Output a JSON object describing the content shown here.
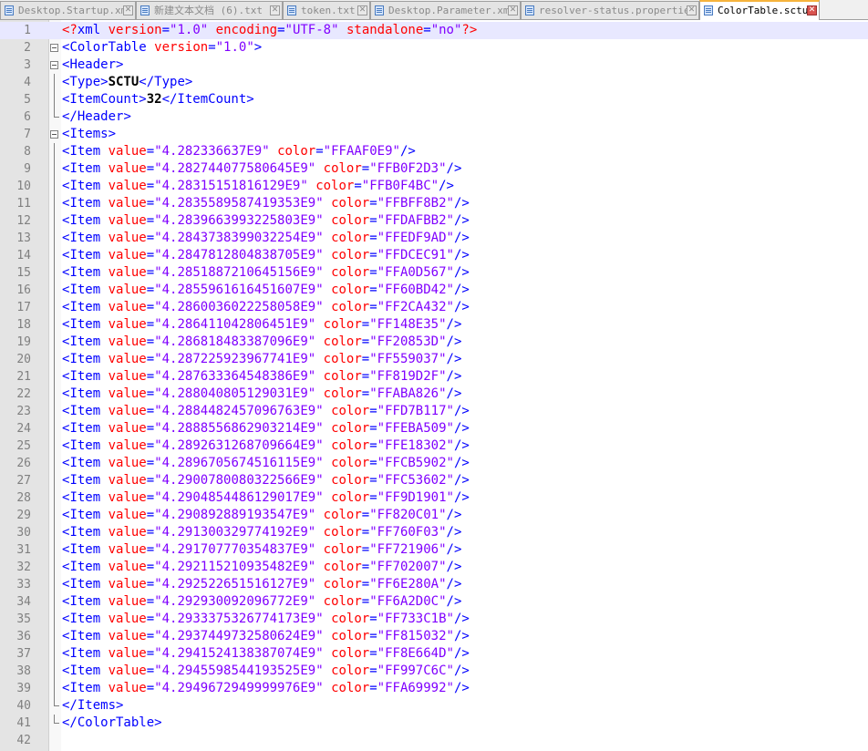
{
  "tabs": [
    {
      "label": "Desktop.Startup.xml",
      "active": false
    },
    {
      "label": "新建文本文档 (6).txt",
      "active": false
    },
    {
      "label": "token.txt",
      "active": false
    },
    {
      "label": "Desktop.Parameter.xml",
      "active": false
    },
    {
      "label": "resolver-status.properties",
      "active": false
    },
    {
      "label": "ColorTable.sctu",
      "active": true
    }
  ],
  "colors": {
    "tag": "#0000ff",
    "attribute": "#ff0000",
    "value": "#8000ff",
    "active_tab_accent": "#f6b33c",
    "current_line": "#e8e8ff"
  },
  "icons": {
    "tab": "document-icon",
    "close": "close-icon",
    "fold": "fold-minus-icon"
  },
  "document": {
    "prolog": {
      "version": "\"1.0\"",
      "encoding": "\"UTF-8\"",
      "standalone": "\"no\""
    },
    "root": {
      "tag": "ColorTable",
      "version": "\"1.0\""
    },
    "header": {
      "tag": "Header",
      "type": "SCTU",
      "item_count": "32"
    },
    "items_tag": "Items",
    "item_tag": "Item",
    "items": [
      {
        "value": "\"4.282336637E9\"",
        "color": "\"FFAAF0E9\""
      },
      {
        "value": "\"4.282744077580645E9\"",
        "color": "\"FFB0F2D3\""
      },
      {
        "value": "\"4.28315151816129E9\"",
        "color": "\"FFB0F4BC\""
      },
      {
        "value": "\"4.2835589587419353E9\"",
        "color": "\"FFBFF8B2\""
      },
      {
        "value": "\"4.2839663993225803E9\"",
        "color": "\"FFDAFBB2\""
      },
      {
        "value": "\"4.2843738399032254E9\"",
        "color": "\"FFEDF9AD\""
      },
      {
        "value": "\"4.2847812804838705E9\"",
        "color": "\"FFDCEC91\""
      },
      {
        "value": "\"4.2851887210645156E9\"",
        "color": "\"FFA0D567\""
      },
      {
        "value": "\"4.2855961616451607E9\"",
        "color": "\"FF60BD42\""
      },
      {
        "value": "\"4.2860036022258058E9\"",
        "color": "\"FF2CA432\""
      },
      {
        "value": "\"4.286411042806451E9\"",
        "color": "\"FF148E35\""
      },
      {
        "value": "\"4.286818483387096E9\"",
        "color": "\"FF20853D\""
      },
      {
        "value": "\"4.287225923967741E9\"",
        "color": "\"FF559037\""
      },
      {
        "value": "\"4.287633364548386E9\"",
        "color": "\"FF819D2F\""
      },
      {
        "value": "\"4.288040805129031E9\"",
        "color": "\"FFABA826\""
      },
      {
        "value": "\"4.2884482457096763E9\"",
        "color": "\"FFD7B117\""
      },
      {
        "value": "\"4.2888556862903214E9\"",
        "color": "\"FFEBA509\""
      },
      {
        "value": "\"4.2892631268709664E9\"",
        "color": "\"FFE18302\""
      },
      {
        "value": "\"4.2896705674516115E9\"",
        "color": "\"FFCB5902\""
      },
      {
        "value": "\"4.2900780080322566E9\"",
        "color": "\"FFC53602\""
      },
      {
        "value": "\"4.2904854486129017E9\"",
        "color": "\"FF9D1901\""
      },
      {
        "value": "\"4.290892889193547E9\"",
        "color": "\"FF820C01\""
      },
      {
        "value": "\"4.291300329774192E9\"",
        "color": "\"FF760F03\""
      },
      {
        "value": "\"4.291707770354837E9\"",
        "color": "\"FF721906\""
      },
      {
        "value": "\"4.292115210935482E9\"",
        "color": "\"FF702007\""
      },
      {
        "value": "\"4.292522651516127E9\"",
        "color": "\"FF6E280A\""
      },
      {
        "value": "\"4.292930092096772E9\"",
        "color": "\"FF6A2D0C\""
      },
      {
        "value": "\"4.2933375326774173E9\"",
        "color": "\"FF733C1B\""
      },
      {
        "value": "\"4.2937449732580624E9\"",
        "color": "\"FF815032\""
      },
      {
        "value": "\"4.2941524138387074E9\"",
        "color": "\"FF8E664D\""
      },
      {
        "value": "\"4.2945598544193525E9\"",
        "color": "\"FF997C6C\""
      },
      {
        "value": "\"4.2949672949999976E9\"",
        "color": "\"FFA69992\""
      }
    ]
  }
}
